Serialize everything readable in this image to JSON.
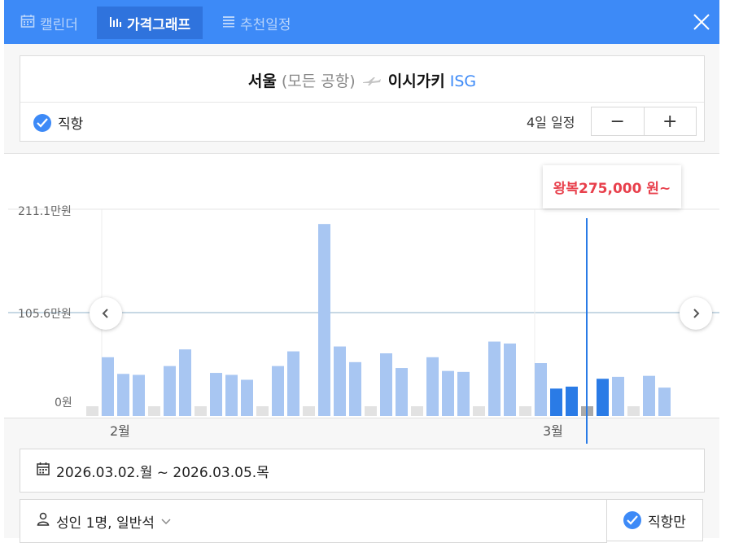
{
  "tabs": [
    {
      "label": "캘린더",
      "icon": "calendar-icon"
    },
    {
      "label": "가격그래프",
      "icon": "bar-chart-icon"
    },
    {
      "label": "추천일정",
      "icon": "list-icon"
    }
  ],
  "route": {
    "origin": "서울",
    "origin_sub": "(모든 공항)",
    "destination": "이시가키",
    "destination_code": "ISG"
  },
  "options": {
    "direct_label": "직항",
    "days_label": "4일 일정",
    "minus": "−",
    "plus": "+"
  },
  "tooltip": {
    "text": "왕복275,000 원~"
  },
  "search": {
    "dates": "2026.03.02.월 ~ 2026.03.05.목",
    "passengers": "성인 1명, 일반석",
    "direct_only": "직항만"
  },
  "colors": {
    "accent": "#3d8af7",
    "bar_light": "#a8c6f2",
    "bar_selected": "#2a7be6",
    "bar_empty": "#e2e2e2",
    "bar_highlight": "#aaaaaa",
    "price_red": "#e8404c"
  },
  "chart_data": {
    "type": "bar",
    "ytick_labels": [
      "211.1만원",
      "105.6만원",
      "0원"
    ],
    "yticks": [
      211.1,
      105.6,
      0
    ],
    "ylim": [
      0,
      211.1
    ],
    "month_labels": [
      "2월",
      "3월"
    ],
    "selected_category_index": 32,
    "values": [
      0,
      60,
      43,
      42,
      0,
      51,
      68,
      0,
      44,
      42,
      37,
      0,
      51,
      66,
      0,
      196,
      71,
      55,
      0,
      64,
      49,
      0,
      60,
      46,
      45,
      0,
      76,
      74,
      0,
      54,
      28,
      30,
      0,
      38,
      40,
      0,
      41,
      29
    ],
    "bar_states": [
      "empty",
      "normal",
      "normal",
      "normal",
      "empty",
      "normal",
      "normal",
      "empty",
      "normal",
      "normal",
      "normal",
      "empty",
      "normal",
      "normal",
      "empty",
      "normal",
      "normal",
      "normal",
      "empty",
      "normal",
      "normal",
      "empty",
      "normal",
      "normal",
      "normal",
      "empty",
      "normal",
      "normal",
      "empty",
      "normal",
      "selected",
      "selected",
      "highlight",
      "selected",
      "normal",
      "empty",
      "normal",
      "normal"
    ]
  }
}
